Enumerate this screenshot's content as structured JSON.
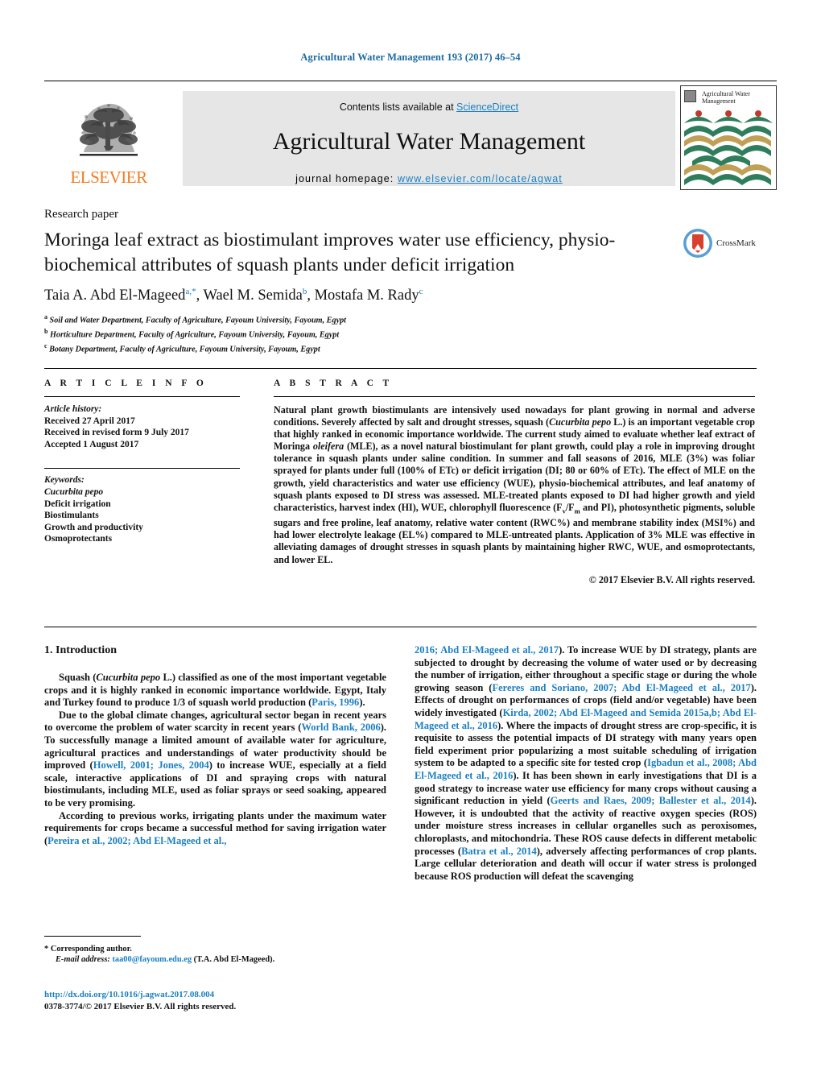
{
  "running_head": "Agricultural Water Management 193 (2017) 46–54",
  "masthead": {
    "contents_prefix": "Contents lists available at ",
    "sciencedirect": "ScienceDirect",
    "journal_name": "Agricultural Water Management",
    "homepage_prefix": "journal homepage: ",
    "homepage_url": "www.elsevier.com/locate/agwat",
    "elsevier_wordmark": "ELSEVIER",
    "cover_title": "Agricultural Water Management",
    "accent_blue": "#1a7fc1",
    "elsevier_orange": "#f47c20"
  },
  "article": {
    "type_label": "Research paper",
    "title": "Moringa leaf extract as biostimulant improves water use efficiency, physio-biochemical attributes of squash plants under deficit irrigation",
    "crossmark_label": "CrossMark",
    "authors_html": "Taia A. Abd El-Mageed<sup>a,*</sup>, Wael M. Semida<sup>b</sup>, Mostafa M. Rady<sup>c</sup>",
    "affiliations": [
      {
        "marker": "a",
        "text": "Soil and Water Department, Faculty of Agriculture, Fayoum University, Fayoum, Egypt"
      },
      {
        "marker": "b",
        "text": "Horticulture Department, Faculty of Agriculture, Fayoum University, Fayoum, Egypt"
      },
      {
        "marker": "c",
        "text": "Botany Department, Faculty of Agriculture, Fayoum University, Fayoum, Egypt"
      }
    ]
  },
  "info": {
    "heading": "A R T I C L E    I N F O",
    "history_label": "Article history:",
    "history": [
      "Received 27 April 2017",
      "Received in revised form 9 July 2017",
      "Accepted 1 August 2017"
    ],
    "keywords_label": "Keywords:",
    "keywords": [
      "Cucurbita pepo",
      "Deficit irrigation",
      "Biostimulants",
      "Growth and productivity",
      "Osmoprotectants"
    ]
  },
  "abstract": {
    "heading": "A B S T R A C T",
    "body_html": "Natural plant growth biostimulants are intensively used nowadays for plant growing in normal and adverse conditions. Severely affected by salt and drought stresses, squash (<i>Cucurbita pepo</i> L.) is an important vegetable crop that highly ranked in economic importance worldwide. The current study aimed to evaluate whether leaf extract of Moringa <i>oleifera</i> (MLE), as a novel natural biostimulant for plant growth, could play a role in improving drought tolerance in squash plants under saline condition. In summer and fall seasons of 2016, MLE (3%) was foliar sprayed for plants under full (100% of ETc) or deficit irrigation (DI; 80 or 60% of ETc). The effect of MLE on the growth, yield characteristics and water use efficiency (WUE), physio-biochemical attributes, and leaf anatomy of squash plants exposed to DI stress was assessed. MLE-treated plants exposed to DI had higher growth and yield characteristics, harvest index (HI), WUE, chlorophyll fluorescence (F<sub>v</sub>/F<sub>m</sub> and PI), photosynthetic pigments, soluble sugars and free proline, leaf anatomy, relative water content (RWC%) and membrane stability index (MSI%) and had lower electrolyte leakage (EL%) compared to MLE-untreated plants. Application of 3% MLE was effective in alleviating damages of drought stresses in squash plants by maintaining higher RWC, WUE, and osmoprotectants, and lower EL.",
    "copyright": "© 2017 Elsevier B.V. All rights reserved."
  },
  "introduction": {
    "heading": "1.  Introduction",
    "left_paragraphs_html": [
      "Squash (<i>Cucurbita pepo</i> L.) classified as one of the most important vegetable crops and it is highly ranked in economic importance worldwide. Egypt, Italy and Turkey found to produce 1/3 of squash world production (<a class=\"ref\" href=\"#\">Paris, 1996</a>).",
      "Due to the global climate changes, agricultural sector began in recent years to overcome the problem of water scarcity in recent years (<a class=\"ref\" href=\"#\">World Bank, 2006</a>). To successfully manage a limited amount of available water for agriculture, agricultural practices and understandings of water productivity should be improved (<a class=\"ref\" href=\"#\">Howell, 2001; Jones, 2004</a>) to increase WUE, especially at a field scale, interactive applications of DI and spraying crops with natural biostimulants, including MLE, used as foliar sprays or seed soaking, appeared to be very promising.",
      "According to previous works, irrigating plants under the maximum water requirements for crops became a successful method for saving irrigation water (<a class=\"ref\" href=\"#\">Pereira et al., 2002; Abd El-Mageed et al.,</a>"
    ],
    "right_paragraphs_html": [
      "<a class=\"ref\" href=\"#\">2016; Abd El-Mageed et al., 2017</a>). To increase WUE by DI strategy, plants are subjected to drought by decreasing the volume of water used or by decreasing the number of irrigation, either throughout a specific stage or during the whole growing season (<a class=\"ref\" href=\"#\">Fereres and Soriano, 2007; Abd El-Mageed et al., 2017</a>). Effects of drought on performances of crops (field and/or vegetable) have been widely investigated (<a class=\"ref\" href=\"#\">Kirda, 2002; Abd El-Mageed and Semida 2015a,b; Abd El-Mageed et al., 2016</a>). Where the impacts of drought stress are crop-specific, it is requisite to assess the potential impacts of DI strategy with many years open field experiment prior popularizing a most suitable scheduling of irrigation system to be adapted to a specific site for tested crop (<a class=\"ref\" href=\"#\">Igbadun et al., 2008; Abd El-Mageed et al., 2016</a>). It has been shown in early investigations that DI is a good strategy to increase water use efficiency for many crops without causing a significant reduction in yield (<a class=\"ref\" href=\"#\">Geerts and Raes, 2009; Ballester et al., 2014</a>). However, it is undoubted that the activity of reactive oxygen species (ROS) under moisture stress increases in cellular organelles such as peroxisomes, chloroplasts, and mitochondria. These ROS cause defects in different metabolic processes (<a class=\"ref\" href=\"#\">Batra et al., 2014</a>), adversely affecting performances of crop plants. Large cellular deterioration and death will occur if water stress is prolonged because ROS production will defeat the scavenging"
    ]
  },
  "footer": {
    "corresponding_marker": "*",
    "corresponding_label": "Corresponding author.",
    "email_label": "E-mail address:",
    "email": "taa00@fayoum.edu.eg",
    "email_owner": "(T.A. Abd El-Mageed).",
    "doi_url": "http://dx.doi.org/10.1016/j.agwat.2017.08.004",
    "issn_line": "0378-3774/© 2017 Elsevier B.V. All rights reserved."
  }
}
